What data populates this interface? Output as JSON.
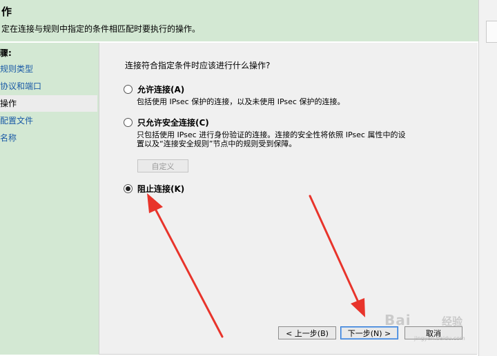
{
  "header": {
    "title": "作",
    "subtitle": "定在连接与规则中指定的条件相匹配时要执行的操作。"
  },
  "sidebar": {
    "heading": "骤:",
    "items": [
      {
        "label": "规则类型"
      },
      {
        "label": "协议和端口"
      },
      {
        "label": "操作"
      },
      {
        "label": "配置文件"
      },
      {
        "label": "名称"
      }
    ],
    "active_index": 2
  },
  "main": {
    "question": "连接符合指定条件时应该进行什么操作?",
    "options": [
      {
        "label": "允许连接(A)",
        "checked": false,
        "description": [
          "包括使用 IPsec 保护的连接，以及未使用 IPsec 保护的连接。"
        ]
      },
      {
        "label": "只允许安全连接(C)",
        "checked": false,
        "description": [
          "只包括使用 IPsec 进行身份验证的连接。连接的安全性将依照 IPsec 属性中的设",
          "置以及“连接安全规则”节点中的规则受到保障。"
        ],
        "customize_label": "自定义"
      },
      {
        "label": "阻止连接(K)",
        "checked": true,
        "description": []
      }
    ]
  },
  "buttons": {
    "back": "< 上一步(B)",
    "next": "下一步(N) >",
    "cancel": "取消"
  },
  "watermark": {
    "brand": "Bai",
    "suffix": "经验",
    "url": "jingyan.baidu.com"
  },
  "colors": {
    "header_bg": "#d3e8d3",
    "sidebar_link": "#1a5aa6",
    "annotation_arrow": "#e8342b"
  }
}
